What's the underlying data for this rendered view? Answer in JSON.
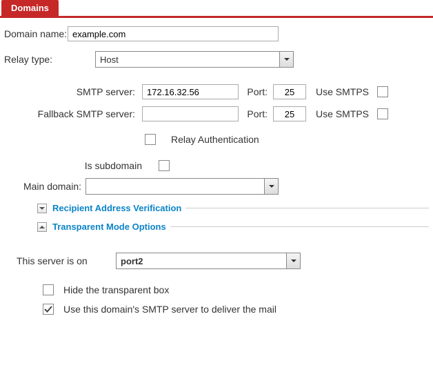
{
  "tab": {
    "label": "Domains"
  },
  "domain_name": {
    "label": "Domain name:",
    "value": "example.com"
  },
  "relay_type": {
    "label": "Relay type:",
    "value": "Host"
  },
  "smtp": {
    "server_label": "SMTP server:",
    "server_value": "172.16.32.56",
    "port_label": "Port:",
    "port_value": "25",
    "use_smtps_label": "Use SMTPS"
  },
  "fallback": {
    "server_label": "Fallback SMTP server:",
    "server_value": "",
    "port_label": "Port:",
    "port_value": "25",
    "use_smtps_label": "Use SMTPS"
  },
  "relay_auth": {
    "label": "Relay Authentication"
  },
  "is_subdomain": {
    "label": "Is subdomain"
  },
  "main_domain": {
    "label": "Main domain:",
    "value": ""
  },
  "sections": {
    "rav": "Recipient Address Verification",
    "tmo": "Transparent Mode Options"
  },
  "server_on": {
    "label": "This server is on",
    "value": "port2"
  },
  "hide_box": {
    "label": "Hide the transparent box"
  },
  "use_domain_smtp": {
    "label": "Use this domain's SMTP server to deliver the mail"
  }
}
